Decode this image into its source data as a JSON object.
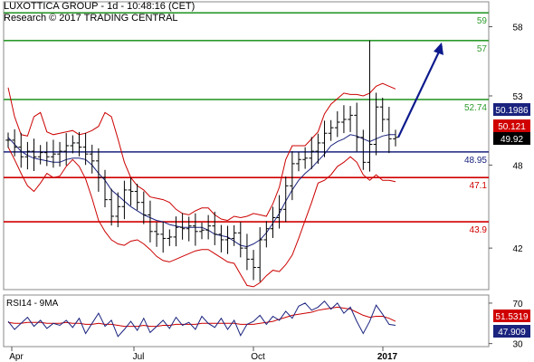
{
  "header": {
    "title": "LUXOTTICA GROUP - 1d - 10:48:16 (CET)",
    "research": "Research © 2017 TRADING CENTRAL"
  },
  "chart_data": {
    "type": "line",
    "title": "LUXOTTICA GROUP - 1d - 10:48:16 (CET)",
    "price_ylim": [
      39,
      59.8
    ],
    "y_ticks": [
      58,
      53,
      48,
      42
    ],
    "x_ticks": [
      "Apr",
      "Jul",
      "Oct",
      "2017"
    ],
    "levels": [
      {
        "value": 59,
        "label": "59",
        "color": "#2e9a2e"
      },
      {
        "value": 57,
        "label": "57",
        "color": "#2e9a2e"
      },
      {
        "value": 52.74,
        "label": "52.74",
        "color": "#2e9a2e"
      },
      {
        "value": 48.95,
        "label": "48.95",
        "color": "#1a237e"
      },
      {
        "value": 47.1,
        "label": "47.1",
        "color": "#d00000"
      },
      {
        "value": 43.9,
        "label": "43.9",
        "color": "#d00000"
      }
    ],
    "price_badges": [
      {
        "value": 50.1986,
        "label": "50.1986",
        "color": "#1a237e"
      },
      {
        "value": 50.121,
        "label": "50.121",
        "color": "#d00000"
      },
      {
        "value": 49.92,
        "label": "49.92",
        "color": "#000000"
      }
    ],
    "series": [
      {
        "name": "close",
        "color": "#000000",
        "values": [
          49.8,
          49.3,
          48.6,
          49.0,
          48.6,
          48.9,
          48.6,
          48.8,
          49.0,
          49.4,
          49.6,
          49.3,
          48.8,
          48.3,
          47.1,
          45.5,
          44.3,
          45.0,
          46.2,
          46.1,
          45.3,
          44.4,
          43.2,
          43.0,
          42.7,
          42.8,
          43.5,
          43.4,
          43.6,
          43.2,
          43.3,
          43.6,
          43.0,
          42.6,
          42.7,
          43.1,
          42.0,
          41.2,
          40.6,
          42.6,
          43.4,
          44.2,
          44.8,
          46.5,
          48.1,
          48.4,
          48.5,
          49.0,
          49.6,
          50.3,
          50.7,
          51.1,
          51.3,
          51.6,
          50.0,
          48.2,
          49.5,
          52.2,
          51.3,
          49.9,
          50.0
        ]
      }
    ],
    "upper_band": [
      53.6,
      51.5,
      50.2,
      50.1,
      51.5,
      51.8,
      50.4,
      50.2,
      50.3,
      50.4,
      50.5,
      50.2,
      50.3,
      50.5,
      50.8,
      51.8,
      51.5,
      49.9,
      48.2,
      47.1,
      46.5,
      46.2,
      45.7,
      45.6,
      45.5,
      45.3,
      44.8,
      44.5,
      44.4,
      44.7,
      44.9,
      44.9,
      44.4,
      44.1,
      44.0,
      44.3,
      44.2,
      44.3,
      44.5,
      44.4,
      44.3,
      45.2,
      46.4,
      48.4,
      49.4,
      49.4,
      49.4,
      49.9,
      50.4,
      51.7,
      52.4,
      52.8,
      53.2,
      53.1,
      53.1,
      53.0,
      53.2,
      53.7,
      53.9,
      53.7,
      53.5
    ],
    "lower_band": [
      49.3,
      48.4,
      47.4,
      46.5,
      46.1,
      46.7,
      47.4,
      47.1,
      47.2,
      47.9,
      48.4,
      47.9,
      47.0,
      45.6,
      44.0,
      43.2,
      42.6,
      42.3,
      42.2,
      42.5,
      42.6,
      42.3,
      41.9,
      41.4,
      41.1,
      41.0,
      41.2,
      41.4,
      41.6,
      41.8,
      41.9,
      41.9,
      41.6,
      41.3,
      41.0,
      40.9,
      40.1,
      39.3,
      39.2,
      39.5,
      40.0,
      40.4,
      40.3,
      40.8,
      41.5,
      42.7,
      44.0,
      45.3,
      46.7,
      46.9,
      47.3,
      47.9,
      48.2,
      48.6,
      48.2,
      47.3,
      46.9,
      47.3,
      46.9,
      46.9,
      46.8
    ],
    "moving_average": [
      50.0,
      49.5,
      49.0,
      48.7,
      48.5,
      48.4,
      48.3,
      48.2,
      48.2,
      48.4,
      48.5,
      48.5,
      48.4,
      48.0,
      47.4,
      46.9,
      46.2,
      45.8,
      45.4,
      45.0,
      44.7,
      44.4,
      44.2,
      44.0,
      43.9,
      43.7,
      43.6,
      43.5,
      43.5,
      43.5,
      43.5,
      43.3,
      43.0,
      42.9,
      42.8,
      42.5,
      42.2,
      42.1,
      42.3,
      42.6,
      43.1,
      43.8,
      44.5,
      45.4,
      46.2,
      46.9,
      47.4,
      47.8,
      48.3,
      48.8,
      49.4,
      49.7,
      49.9,
      50.2,
      50.1,
      49.9,
      49.7,
      49.9,
      50.1,
      50.2,
      50.2
    ],
    "projection": {
      "from": 50.0,
      "to": 56.6,
      "color": "#0d1a8c"
    },
    "rsi": {
      "title": "RSI14 - 9MA",
      "ylim": [
        27,
        78
      ],
      "y_ticks": [
        70,
        30
      ],
      "rsi_value_label": "47.909",
      "ma_value_label": "51.5319",
      "rsi": [
        52,
        44,
        50,
        56,
        47,
        53,
        45,
        50,
        48,
        53,
        46,
        55,
        40,
        50,
        60,
        47,
        53,
        37,
        44,
        52,
        43,
        55,
        41,
        47,
        53,
        45,
        56,
        48,
        51,
        44,
        57,
        50,
        46,
        55,
        44,
        53,
        38,
        49,
        52,
        58,
        49,
        57,
        53,
        62,
        55,
        67,
        70,
        63,
        66,
        72,
        64,
        70,
        60,
        66,
        52,
        40,
        52,
        68,
        59,
        49,
        48
      ],
      "ma": [
        51,
        50,
        50,
        51,
        51,
        51,
        50,
        50,
        50,
        51,
        50,
        50,
        49,
        49,
        50,
        49,
        49,
        48,
        47,
        47,
        47,
        48,
        47,
        47,
        48,
        48,
        49,
        49,
        49,
        49,
        50,
        50,
        50,
        50,
        50,
        50,
        49,
        49,
        49,
        50,
        51,
        52,
        54,
        56,
        58,
        59,
        60,
        61,
        63,
        64,
        65,
        66,
        65,
        64,
        61,
        58,
        56,
        57,
        57,
        55,
        52
      ]
    }
  }
}
